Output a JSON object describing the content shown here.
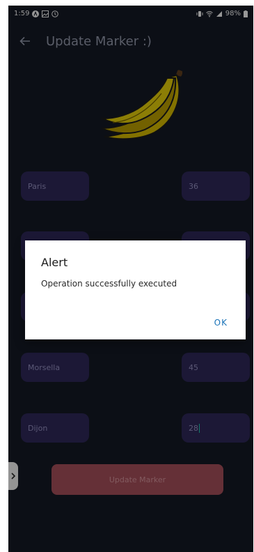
{
  "status_bar": {
    "time": "1:59",
    "battery": "98%",
    "icons": [
      "a-icon",
      "image-icon",
      "circle-icon",
      "vibrate-icon",
      "wifi-icon",
      "signal-icon",
      "battery-icon"
    ]
  },
  "appbar": {
    "title": "Update Marker :)",
    "back_icon": "arrow-left-icon"
  },
  "image": {
    "icon": "banana-icon"
  },
  "fields": [
    {
      "left": "Paris",
      "right": "36"
    },
    {
      "left": "",
      "right": ""
    },
    {
      "left": "",
      "right": ""
    },
    {
      "left": "Morsella",
      "right": "45"
    },
    {
      "left": "Dijon",
      "right": "28"
    }
  ],
  "update_button": {
    "label": "Update Marker"
  },
  "dialog": {
    "title": "Alert",
    "message": "Operation successfully executed",
    "ok_label": "OK"
  },
  "colors": {
    "background": "#131722",
    "field": "#2b2654",
    "button": "#9b4a55",
    "accent": "#1a73b8"
  }
}
